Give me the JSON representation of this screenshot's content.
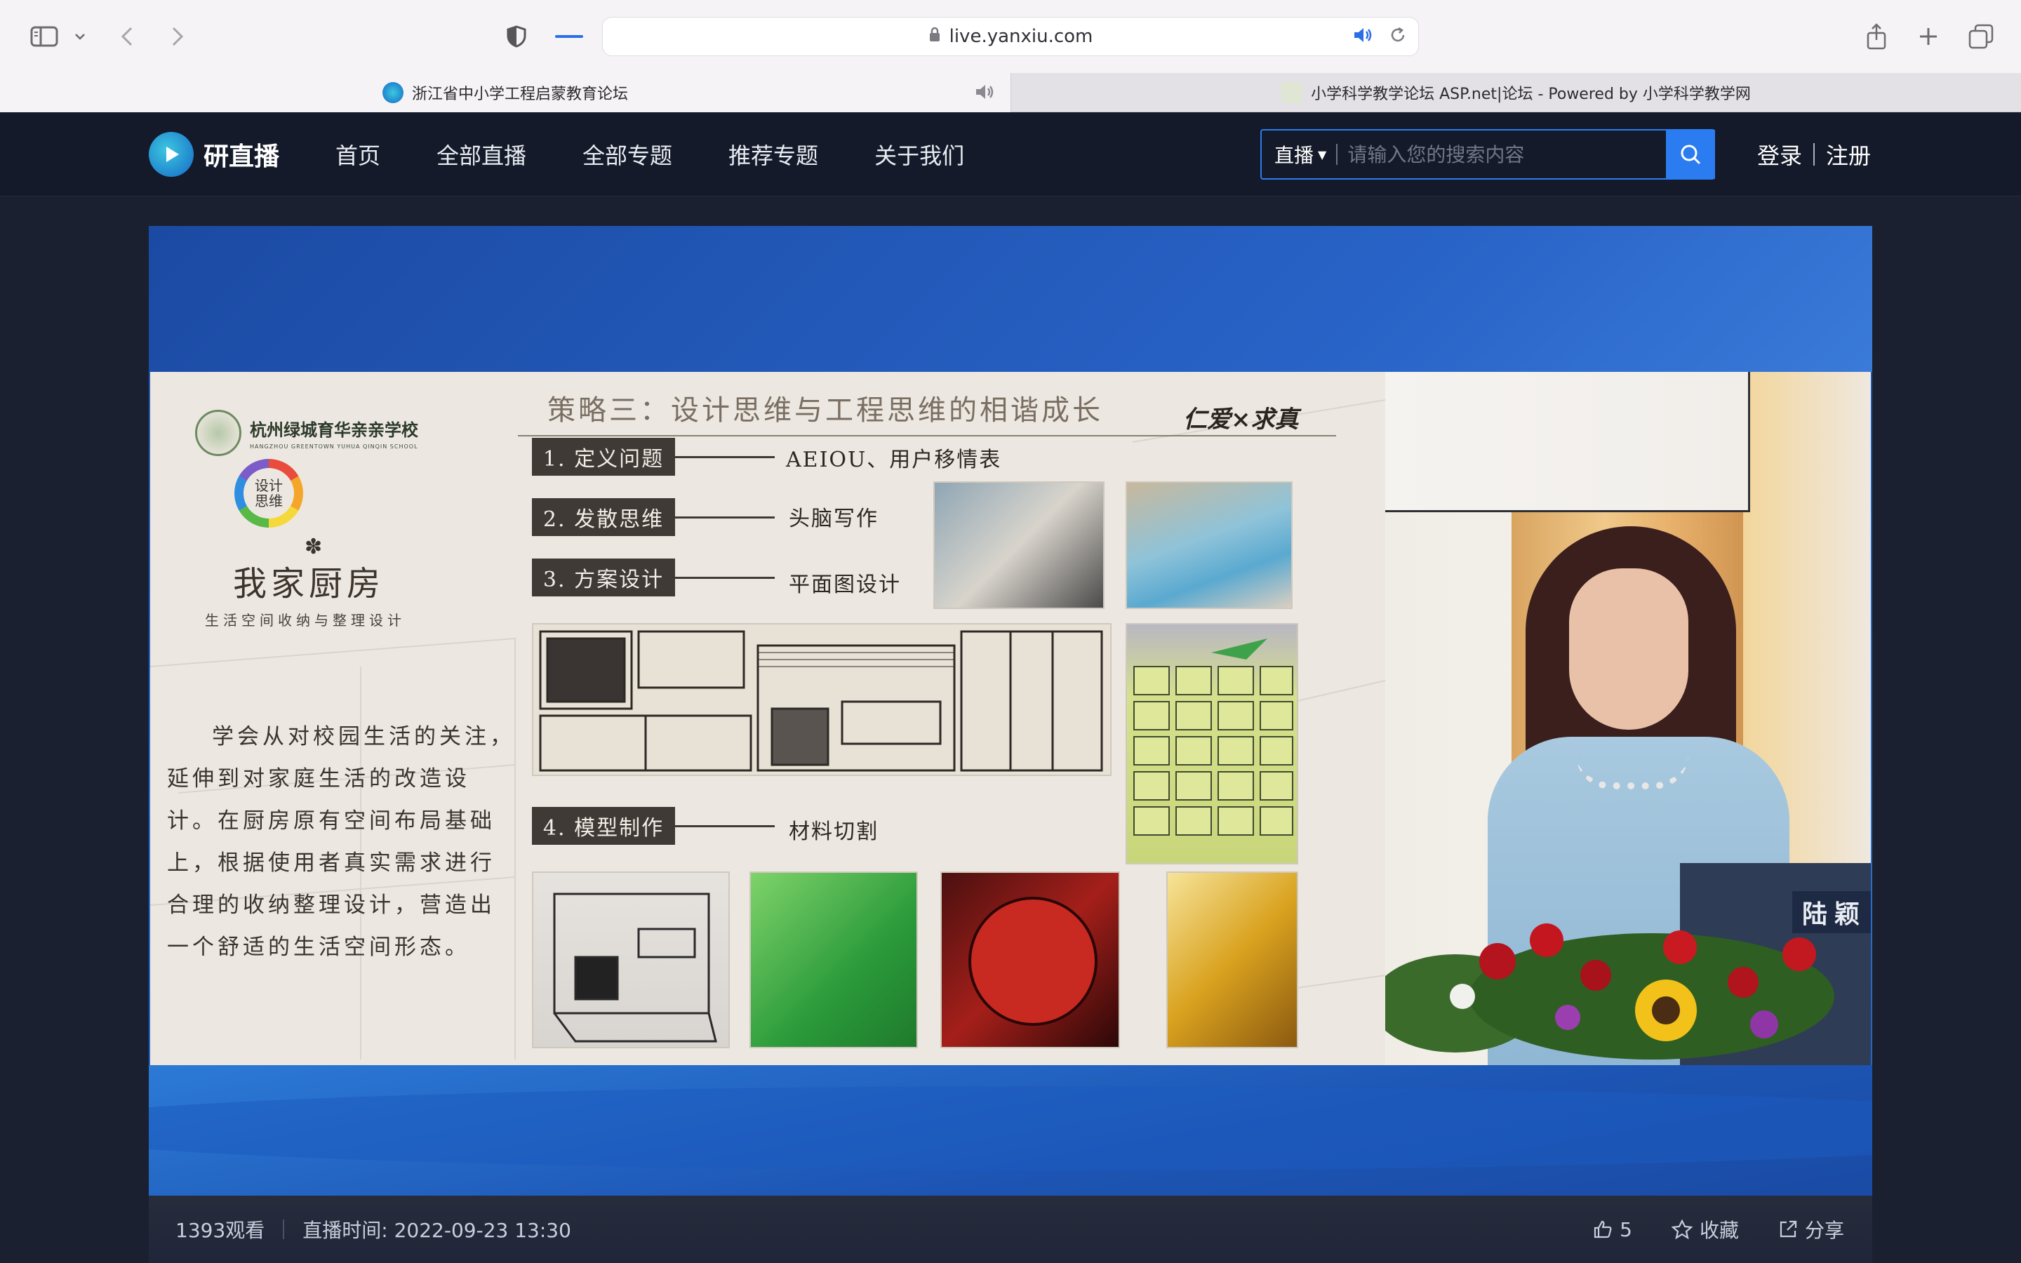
{
  "browser": {
    "url": "live.yanxiu.com",
    "tabs": [
      {
        "title": "浙江省中小学工程启蒙教育论坛",
        "active": true
      },
      {
        "title": "小学科学教学论坛 ASP.net|论坛 - Powered by 小学科学教学网",
        "active": false
      }
    ]
  },
  "site": {
    "logo_text": "研直播",
    "nav": [
      "首页",
      "全部直播",
      "全部专题",
      "推荐专题",
      "关于我们"
    ],
    "search": {
      "type": "直播",
      "placeholder": "请输入您的搜索内容"
    },
    "login": "登录",
    "register": "注册"
  },
  "slide": {
    "school_name": "杭州绿城育华亲亲学校",
    "school_en": "HANGZHOU GREENTOWN YUHUA QINQIN SCHOOL",
    "badge_line1": "设计",
    "badge_line2": "思维",
    "project_title": "我家厨房",
    "project_subtitle": "生活空间收纳与整理设计",
    "paragraph": "学会从对校园生活的关注，延伸到对家庭生活的改造设计。在厨房原有空间布局基础上，根据使用者真实需求进行合理的收纳整理设计，营造出一个舒适的生活空间形态。",
    "title": "策略三：设计思维与工程思维的相谐成长",
    "motto": "仁爱×求真",
    "steps": [
      {
        "label": "1. 定义问题",
        "desc": "AEIOU、用户移情表"
      },
      {
        "label": "2. 发散思维",
        "desc": "头脑写作"
      },
      {
        "label": "3. 方案设计",
        "desc": "平面图设计"
      },
      {
        "label": "4. 模型制作",
        "desc": "材料切割"
      }
    ]
  },
  "speaker": {
    "nameplate": "陆颖"
  },
  "info": {
    "views": "1393观看",
    "live_time": "直播时间: 2022-09-23 13:30",
    "likes": "5",
    "favorite": "收藏",
    "share": "分享"
  },
  "colors": {
    "header_bg": "#141a29",
    "accent": "#2b7cf0",
    "player_blue": "#2b6fd0"
  }
}
